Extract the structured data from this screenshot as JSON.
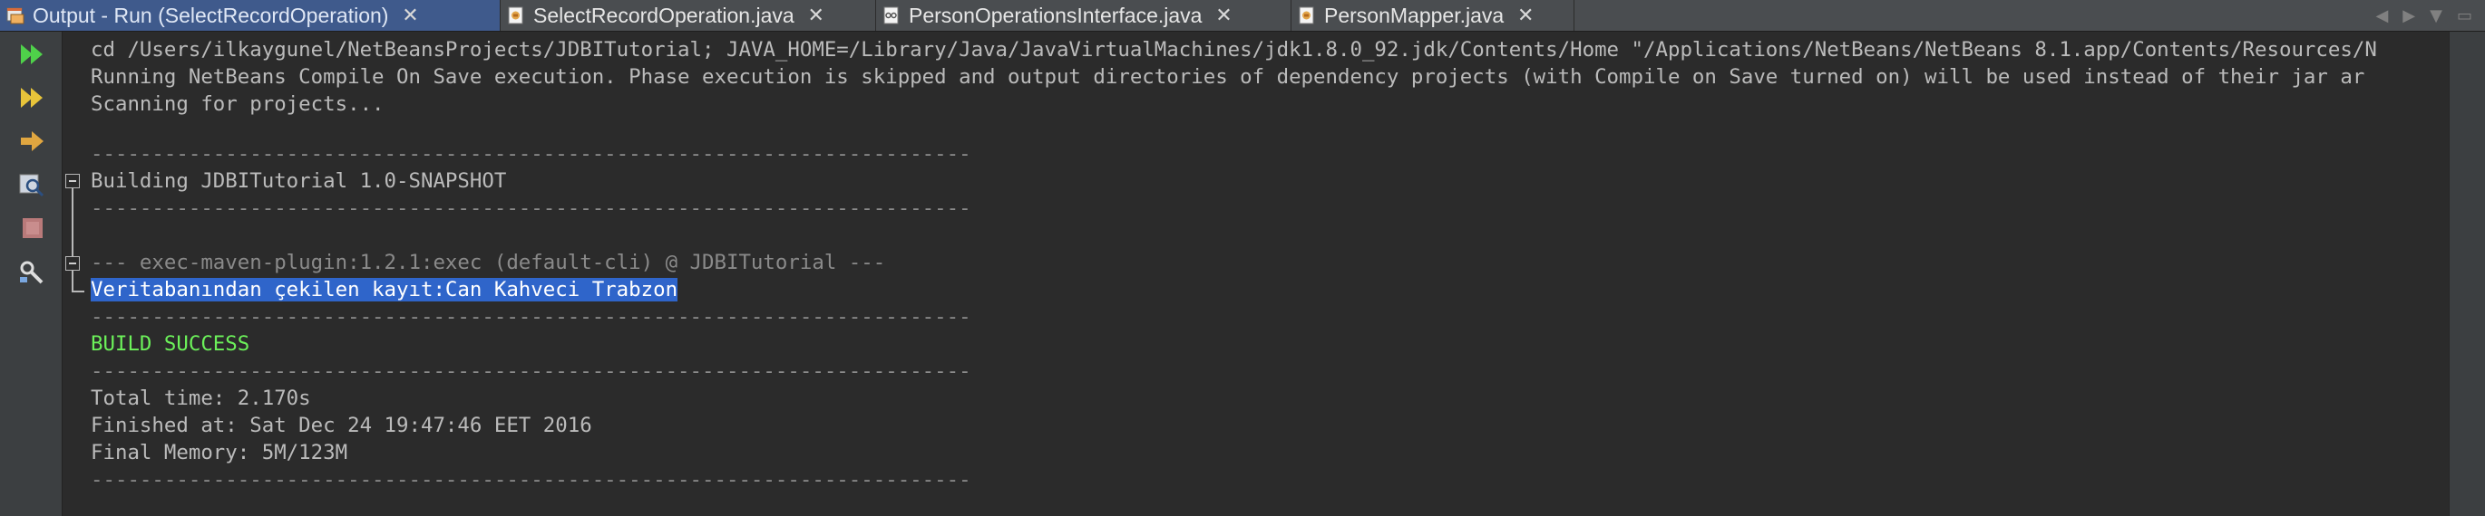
{
  "tabs": [
    {
      "label": "Output - Run (SelectRecordOperation)",
      "icon": "console-icon",
      "active": true
    },
    {
      "label": "SelectRecordOperation.java",
      "icon": "java-file-icon",
      "active": false
    },
    {
      "label": "PersonOperationsInterface.java",
      "icon": "interface-file-icon",
      "active": false
    },
    {
      "label": "PersonMapper.java",
      "icon": "java-file-icon",
      "active": false
    }
  ],
  "tab_close_glyph": "✕",
  "tab_controls": {
    "back": "◀",
    "forward": "▶",
    "menu": "▼",
    "restore": "▭"
  },
  "toolbar": {
    "items": [
      "rerun-icon",
      "rerun-with-options-icon",
      "step-icon",
      "inspect-icon",
      "stop-icon",
      "settings-icon"
    ]
  },
  "colors": {
    "accent": "#3f5a8c",
    "success": "#6cf25a",
    "selection": "#2f65ca",
    "text": "#bbbbbb"
  },
  "output": {
    "cd_line": "cd /Users/ilkaygunel/NetBeansProjects/JDBITutorial; JAVA_HOME=/Library/Java/JavaVirtualMachines/jdk1.8.0_92.jdk/Contents/Home \"/Applications/NetBeans/NetBeans 8.1.app/Contents/Resources/N",
    "compile_on_save": "Running NetBeans Compile On Save execution. Phase execution is skipped and output directories of dependency projects (with Compile on Save turned on) will be used instead of their jar ar",
    "scanning": "Scanning for projects...",
    "separator": "------------------------------------------------------------------------",
    "building": "Building JDBITutorial 1.0-SNAPSHOT",
    "exec_plugin": "--- exec-maven-plugin:1.2.1:exec (default-cli) @ JDBITutorial ---",
    "result": "Veritabanından çekilen kayıt:Can Kahveci Trabzon",
    "build_success": "BUILD SUCCESS",
    "total_time": "Total time: 2.170s",
    "finished_at": "Finished at: Sat Dec 24 19:47:46 EET 2016",
    "final_memory": "Final Memory: 5M/123M"
  }
}
